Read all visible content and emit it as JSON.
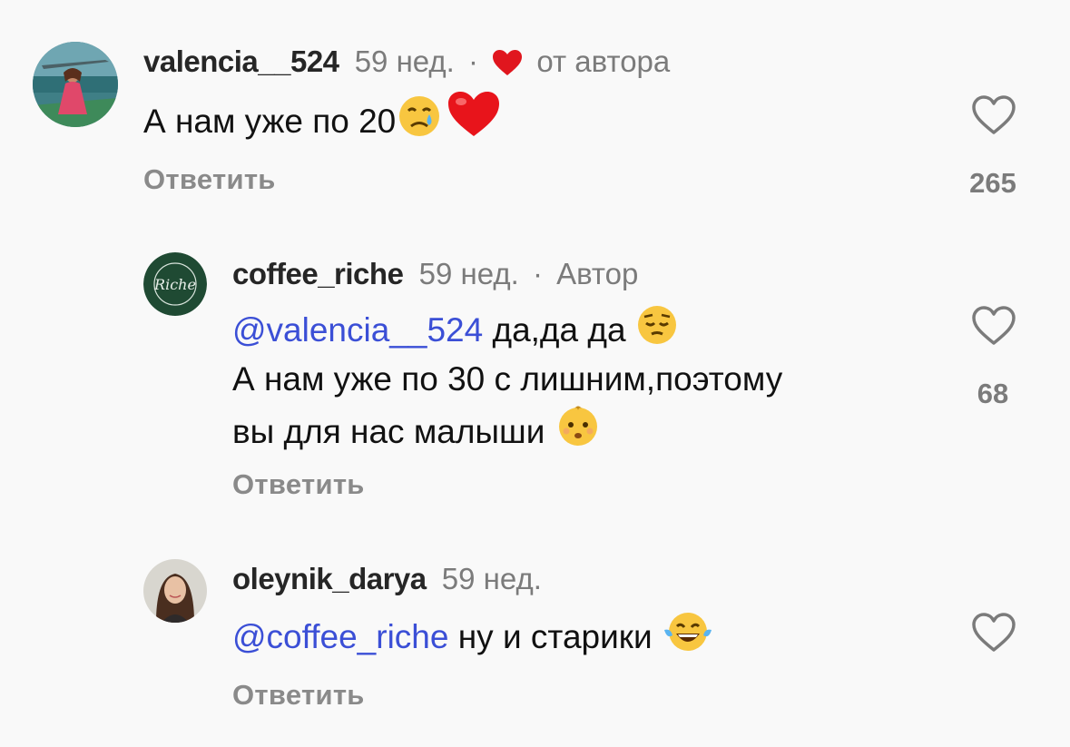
{
  "comments": [
    {
      "username": "valencia__524",
      "time": "59 нед.",
      "separator": "·",
      "author_like_label": "от автора",
      "text": "А нам уже по 20",
      "emojis": [
        "crying-face",
        "red-heart"
      ],
      "reply_label": "Ответить",
      "likes": "265"
    },
    {
      "username": "coffee_riche",
      "time": "59 нед.",
      "separator": "·",
      "tag": "Автор",
      "mention": "@valencia__524",
      "line1": "да,да да",
      "line2": "А нам уже по 30 с лишним,поэтому",
      "line3": "вы для нас малыши",
      "emojis": [
        "pensive-face",
        "baby-face"
      ],
      "reply_label": "Ответить",
      "likes": "68",
      "avatar_logo_text": "Riche"
    },
    {
      "username": "oleynik_darya",
      "time": "59 нед.",
      "mention": "@coffee_riche",
      "text": "ну и старики",
      "emojis": [
        "tears-of-joy-face"
      ],
      "reply_label": "Ответить"
    }
  ],
  "colors": {
    "background": "#f9f9f9",
    "mention": "#3b4fd6",
    "muted": "#7b7b7b",
    "heart_red": "#e0161e",
    "avatar_green": "#1f4a33"
  }
}
